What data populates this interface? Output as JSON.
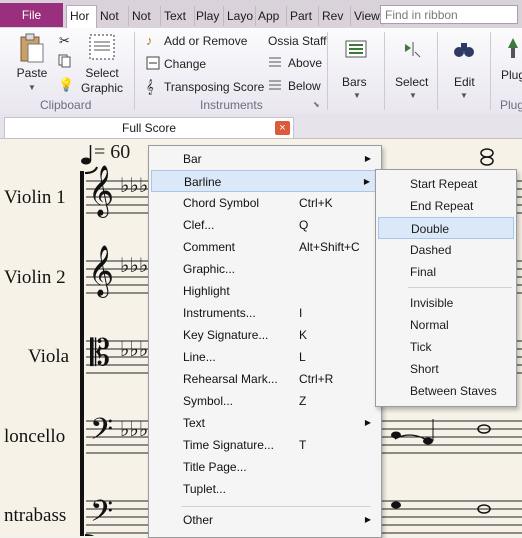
{
  "ribbon": {
    "file_tab": "File",
    "tabs": [
      "Hor",
      "Not",
      "Not",
      "Text",
      "Play",
      "Layo",
      "App",
      "Part",
      "Rev",
      "View"
    ],
    "search_placeholder": "Find in ribbon",
    "clipboard": {
      "paste": "Paste",
      "select_graphic": "Select Graphic",
      "group": "Clipboard"
    },
    "instruments": {
      "add_remove": "Add or Remove",
      "change": "Change",
      "transposing": "Transposing Score",
      "group": "Instruments"
    },
    "ossia": {
      "title": "Ossia Staff",
      "above": "Above",
      "below": "Below"
    },
    "bars": "Bars",
    "select": "Select",
    "edit": "Edit",
    "plugins": "Plug",
    "plugins_group": "Plug"
  },
  "document": {
    "tab_title": "Full Score",
    "close": "×"
  },
  "score": {
    "tempo_value": "= 60",
    "instruments": [
      "Violin 1",
      "Violin 2",
      "Viola",
      "loncello",
      "ntrabass"
    ]
  },
  "context_menu": {
    "items": [
      {
        "label": "Bar",
        "shortcut": "",
        "submenu": true
      },
      {
        "label": "Barline",
        "shortcut": "",
        "submenu": true,
        "highlighted": true
      },
      {
        "label": "Chord Symbol",
        "shortcut": "Ctrl+K"
      },
      {
        "label": "Clef...",
        "shortcut": "Q"
      },
      {
        "label": "Comment",
        "shortcut": "Alt+Shift+C"
      },
      {
        "label": "Graphic...",
        "shortcut": ""
      },
      {
        "label": "Highlight",
        "shortcut": ""
      },
      {
        "label": "Instruments...",
        "shortcut": "I"
      },
      {
        "label": "Key Signature...",
        "shortcut": "K"
      },
      {
        "label": "Line...",
        "shortcut": "L"
      },
      {
        "label": "Rehearsal Mark...",
        "shortcut": "Ctrl+R"
      },
      {
        "label": "Symbol...",
        "shortcut": "Z"
      },
      {
        "label": "Text",
        "shortcut": "",
        "submenu": true
      },
      {
        "label": "Time Signature...",
        "shortcut": "T"
      },
      {
        "label": "Title Page...",
        "shortcut": ""
      },
      {
        "label": "Tuplet...",
        "shortcut": ""
      },
      {
        "label": "Other",
        "shortcut": "",
        "submenu": true
      }
    ]
  },
  "barline_submenu": {
    "items": [
      "Start Repeat",
      "End Repeat",
      "Double",
      "Dashed",
      "Final",
      "Invisible",
      "Normal",
      "Tick",
      "Short",
      "Between Staves"
    ],
    "highlighted": "Double"
  },
  "colors": {
    "file_tab": "#9a2f7e",
    "highlight": "#dbe8f8",
    "close_button": "#dd5a3c",
    "paper": "#f6f2e8"
  }
}
